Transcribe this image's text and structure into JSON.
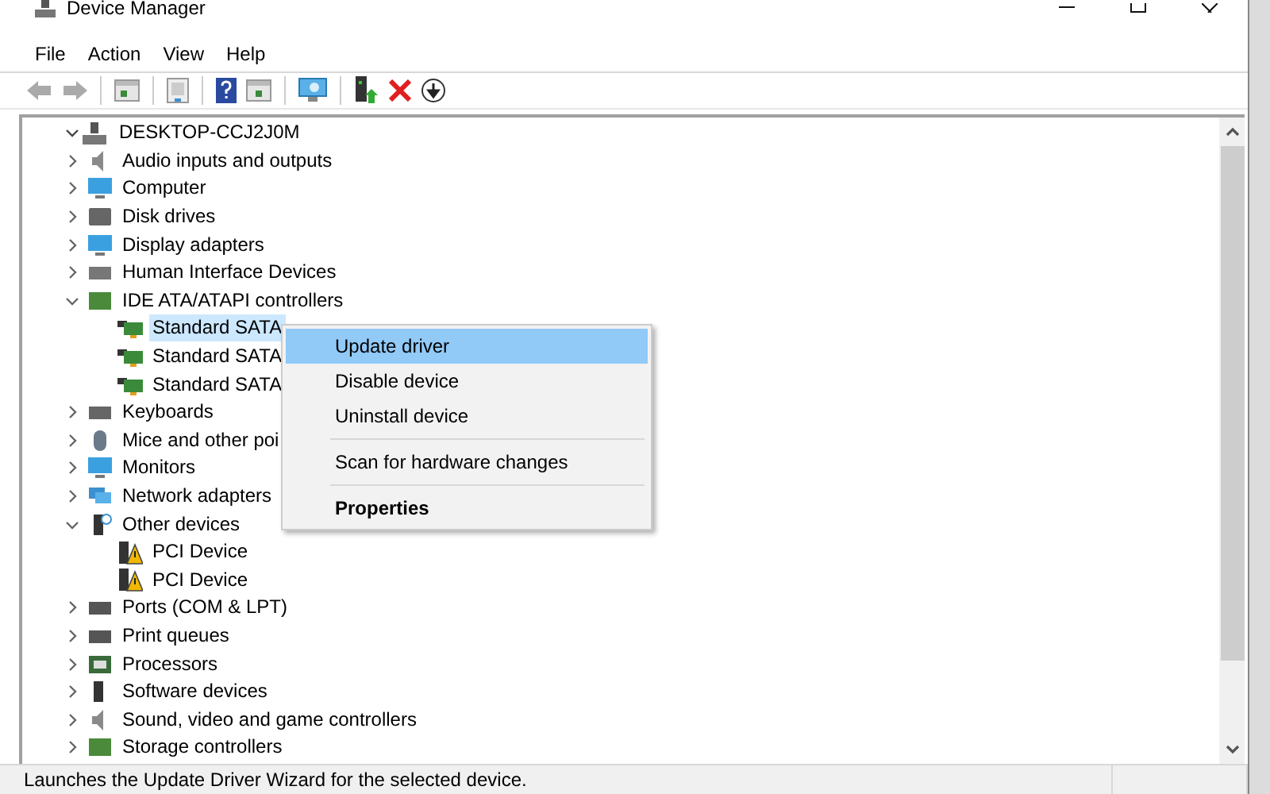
{
  "window": {
    "title": "Device Manager"
  },
  "menu": [
    "File",
    "Action",
    "View",
    "Help"
  ],
  "tree": {
    "label": "DESKTOP-CCJ2J0M",
    "expanded": true,
    "selected": false,
    "children": [
      {
        "label": "Audio inputs and outputs",
        "expanded": false,
        "selected": false
      },
      {
        "label": "Computer",
        "expanded": false,
        "selected": false
      },
      {
        "label": "Disk drives",
        "expanded": false,
        "selected": false
      },
      {
        "label": "Display adapters",
        "expanded": false,
        "selected": false
      },
      {
        "label": "Human Interface Devices",
        "expanded": false,
        "selected": false
      },
      {
        "label": "IDE ATA/ATAPI controllers",
        "expanded": true,
        "selected": false,
        "children": [
          {
            "label": "Standard SATA",
            "selected": true
          },
          {
            "label": "Standard SATA",
            "selected": false
          },
          {
            "label": "Standard SATA",
            "selected": false
          }
        ]
      },
      {
        "label": "Keyboards",
        "expanded": false,
        "selected": false
      },
      {
        "label": "Mice and other poi",
        "expanded": false,
        "selected": false
      },
      {
        "label": "Monitors",
        "expanded": false,
        "selected": false
      },
      {
        "label": "Network adapters",
        "expanded": false,
        "selected": false
      },
      {
        "label": "Other devices",
        "expanded": true,
        "selected": false,
        "children": [
          {
            "label": "PCI Device",
            "selected": false
          },
          {
            "label": "PCI Device",
            "selected": false
          }
        ]
      },
      {
        "label": "Ports (COM & LPT)",
        "expanded": false,
        "selected": false
      },
      {
        "label": "Print queues",
        "expanded": false,
        "selected": false
      },
      {
        "label": "Processors",
        "expanded": false,
        "selected": false
      },
      {
        "label": "Software devices",
        "expanded": false,
        "selected": false
      },
      {
        "label": "Sound, video and game controllers",
        "expanded": false,
        "selected": false
      },
      {
        "label": "Storage controllers",
        "expanded": false,
        "selected": false
      }
    ]
  },
  "context_menu": [
    {
      "kind": "item",
      "label": "Update driver",
      "selected": true,
      "default": false
    },
    {
      "kind": "item",
      "label": "Disable device",
      "selected": false,
      "default": false
    },
    {
      "kind": "item",
      "label": "Uninstall device",
      "selected": false,
      "default": false
    },
    {
      "kind": "separator"
    },
    {
      "kind": "item",
      "label": "Scan for hardware changes",
      "selected": false,
      "default": false
    },
    {
      "kind": "separator"
    },
    {
      "kind": "item",
      "label": "Properties",
      "selected": false,
      "default": true
    }
  ],
  "status_bar": "Launches the Update Driver Wizard for the selected device."
}
